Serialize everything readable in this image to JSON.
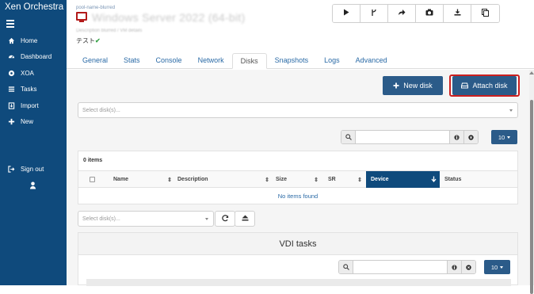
{
  "app": {
    "name": "Xen Orchestra"
  },
  "sidebar": {
    "items": [
      {
        "label": "Home",
        "icon": "home-icon"
      },
      {
        "label": "Dashboard",
        "icon": "dashboard-icon"
      },
      {
        "label": "XOA",
        "icon": "xoa-icon"
      },
      {
        "label": "Tasks",
        "icon": "tasks-icon"
      },
      {
        "label": "Import",
        "icon": "import-icon"
      },
      {
        "label": "New",
        "icon": "plus-icon"
      }
    ],
    "signout": "Sign out"
  },
  "vm": {
    "pool": "pool-name-blurred",
    "title": "Windows Server 2022 (64-bit)",
    "description": "Description blurred / VM details",
    "tag": "テスト",
    "tag_check": "✔"
  },
  "toolbar": {
    "buttons": [
      "play-icon",
      "fork-icon",
      "share-icon",
      "camera-icon",
      "download-icon",
      "copy-icon"
    ]
  },
  "tabs": [
    "General",
    "Stats",
    "Console",
    "Network",
    "Disks",
    "Snapshots",
    "Logs",
    "Advanced"
  ],
  "active_tab": "Disks",
  "disks": {
    "new_disk_label": "New disk",
    "attach_disk_label": "Attach disk",
    "select_placeholder": "Select disk(s)...",
    "page_size": "10",
    "items_count": "0 items",
    "columns": [
      "Name",
      "Description",
      "Size",
      "SR",
      "Device",
      "Status"
    ],
    "empty_text": "No items found",
    "bottom_select_placeholder": "Select disk(s)..."
  },
  "vdi_tasks": {
    "title": "VDI tasks",
    "page_size": "10"
  },
  "colors": {
    "sidebar": "#0f4a7c",
    "primary_button": "#2b5b89",
    "highlight": "#cc1f1f",
    "link": "#2a6aa6"
  }
}
